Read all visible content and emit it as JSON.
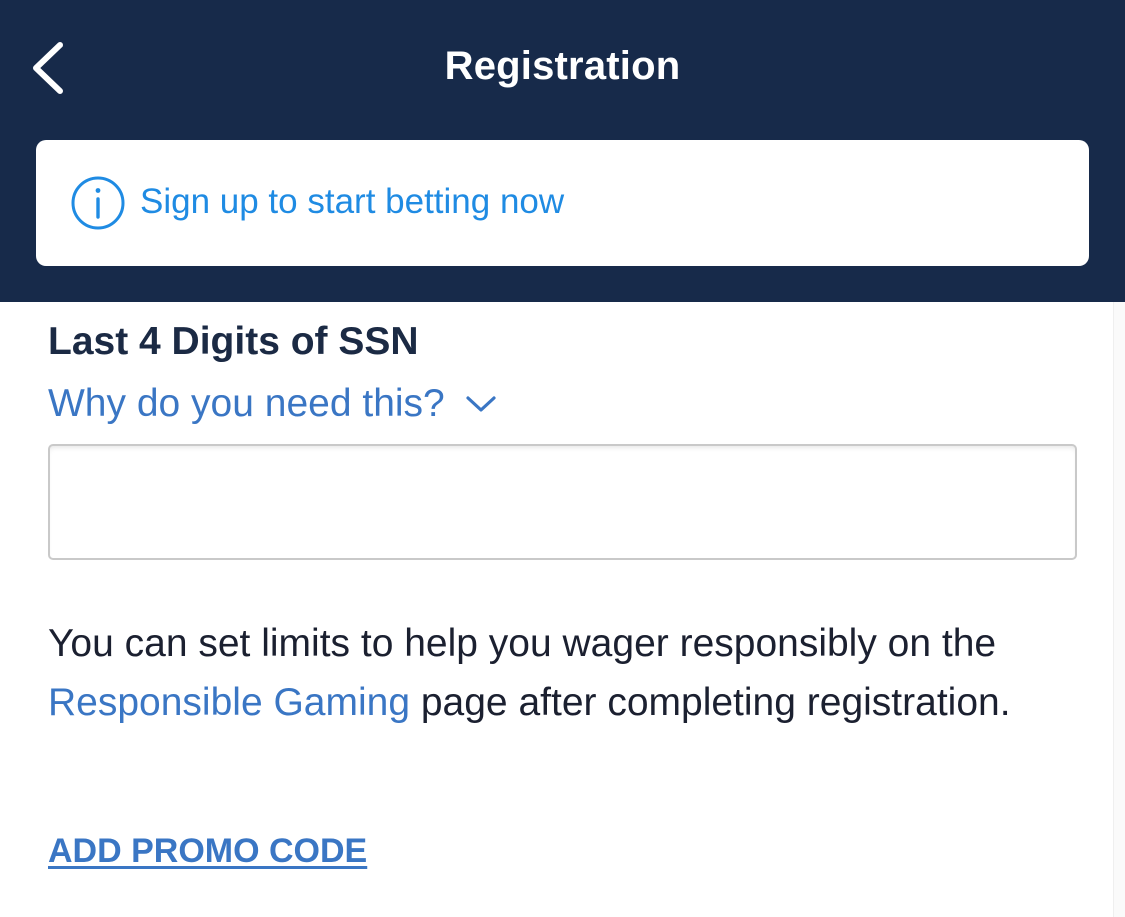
{
  "header": {
    "title": "Registration",
    "back_icon": "chevron-left-icon",
    "background": "#172a4a"
  },
  "banner": {
    "icon": "info-icon",
    "text": "Sign up to start betting now",
    "accent": "#1f8be3"
  },
  "ssn_field": {
    "label": "Last 4 Digits of SSN",
    "help_link": "Why do you need this?",
    "help_icon": "chevron-down-icon",
    "value": ""
  },
  "limits": {
    "text_before": "You can set limits to help you wager responsibly on the ",
    "link": "Responsible Gaming",
    "text_after": " page after completing registration."
  },
  "promo": {
    "label": "ADD PROMO CODE"
  },
  "colors": {
    "link": "#3a76c4",
    "text": "#1b2030"
  }
}
